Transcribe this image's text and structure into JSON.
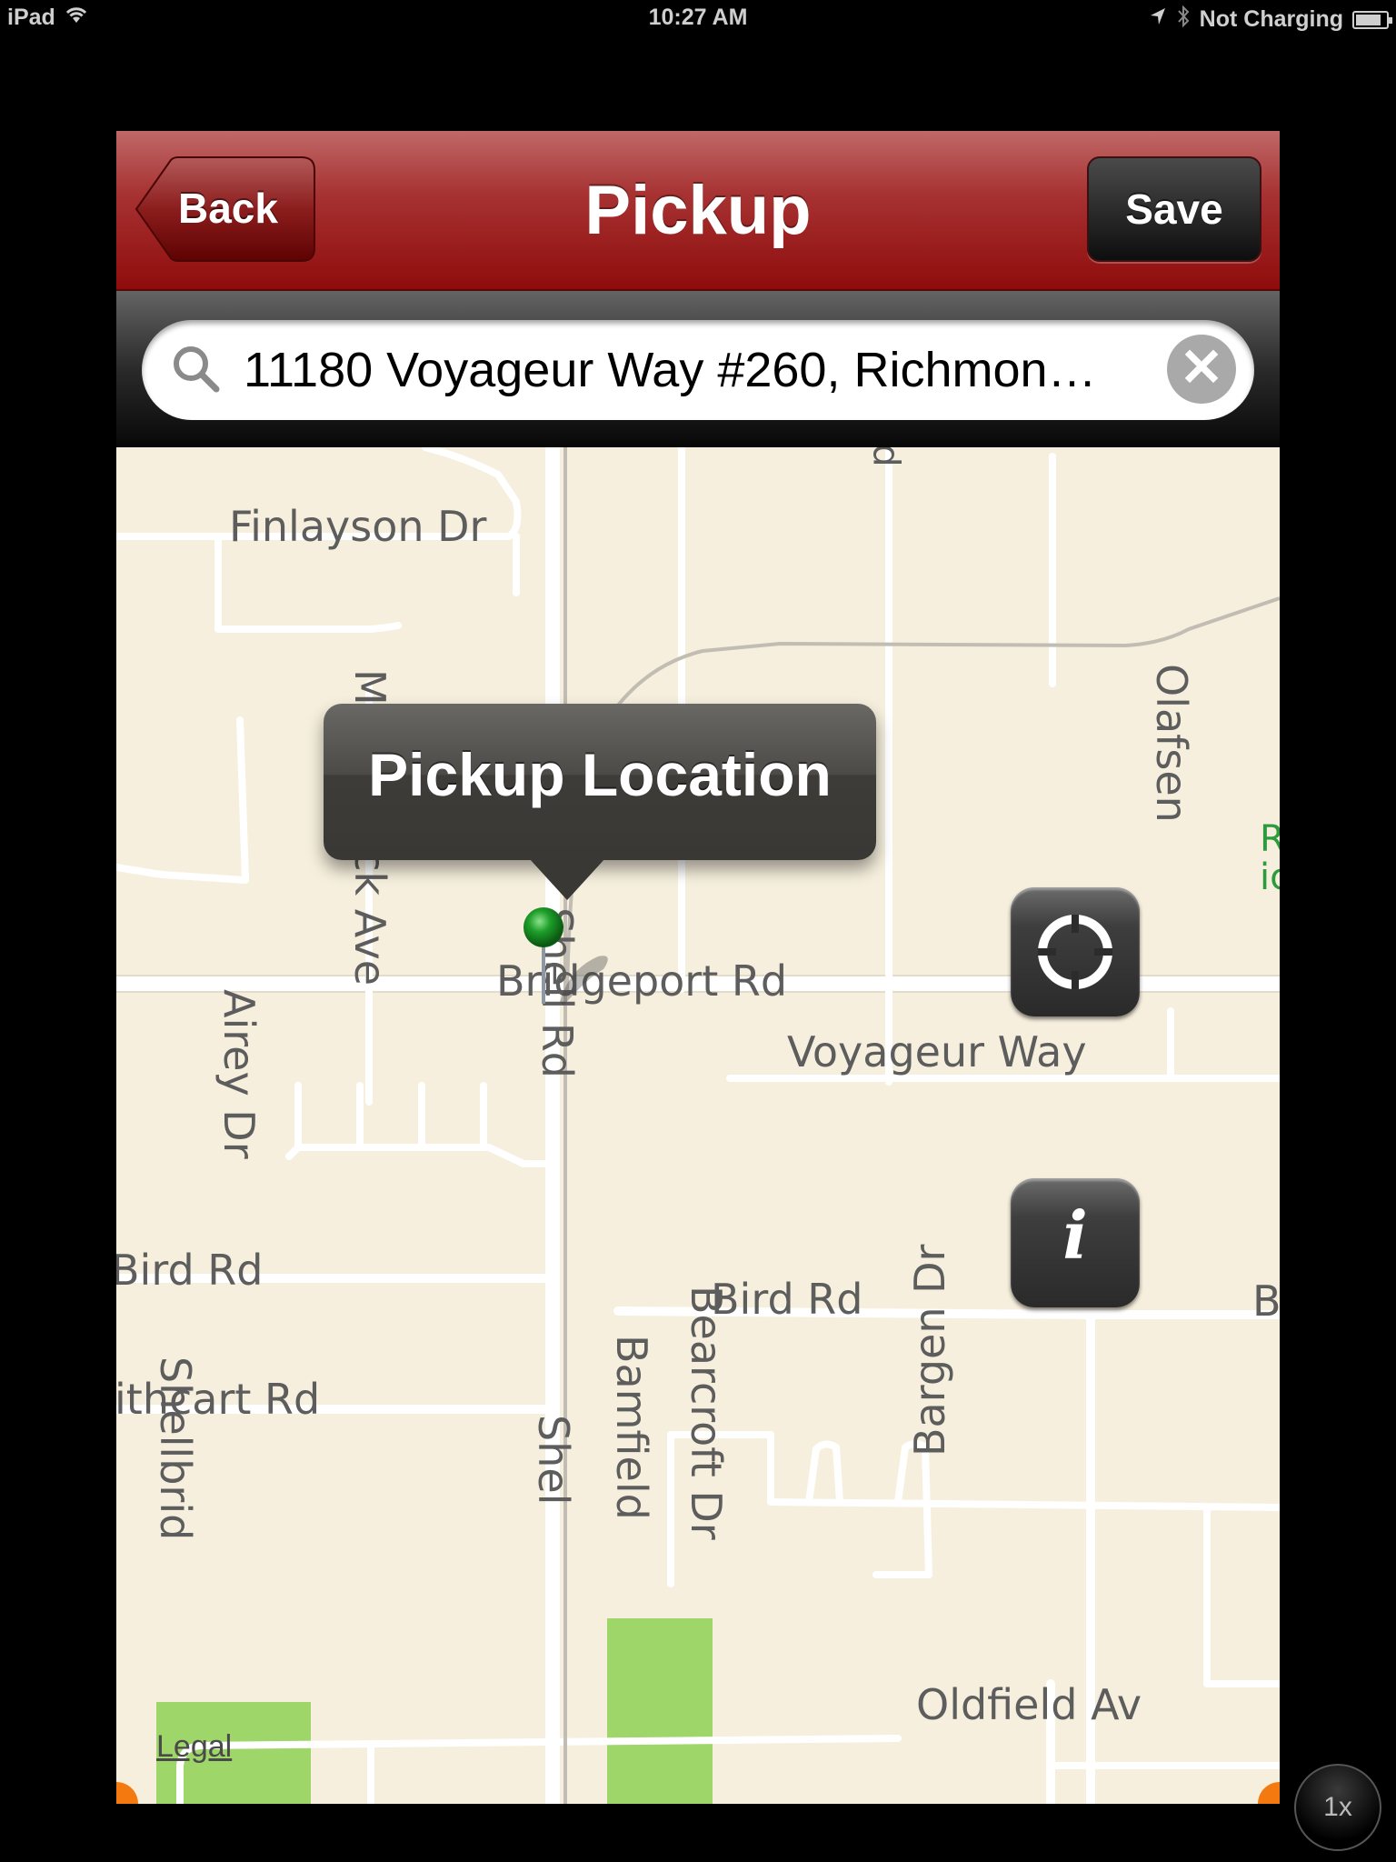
{
  "status_bar": {
    "device": "iPad",
    "time": "10:27 AM",
    "charging_status": "Not Charging",
    "battery_level": 0.85,
    "icons": [
      "wifi-icon",
      "location-arrow-icon",
      "bluetooth-icon",
      "battery-icon"
    ]
  },
  "navbar": {
    "title": "Pickup",
    "back_label": "Back",
    "save_label": "Save"
  },
  "search": {
    "value": "11180 Voyageur Way #260, Richmon…",
    "icon": "search-icon",
    "clear_icon": "clear-icon"
  },
  "map": {
    "callout_title": "Pickup Location",
    "pin_color": "#1e9e2a",
    "legal_label": "Legal",
    "streets": {
      "finlayson": "Finlayson Dr",
      "mckessock": "McKessock Ave",
      "bridgeport": "Bridgeport Rd",
      "airey": "Airey Dr",
      "shell": "Shell Rd",
      "voyageur": "Voyageur Way",
      "olafsen": "Olafsen",
      "bird_left": "Bird Rd",
      "bird_center": "Bird Rd",
      "bird_right": "Bi",
      "cathcart": "ithcart Rd",
      "shellbridge": "Shellbrid",
      "shell_bottom": "Shel",
      "bamfield": "Bamfield",
      "bearcroft": "Bearcroft Dr",
      "bargen": "Bargen Dr",
      "oldfield": "Oldfield Av",
      "top_partial": "d",
      "green_partial_1": "Ri",
      "green_partial_2": "ic"
    },
    "controls": {
      "locate_icon": "crosshair-icon",
      "info_label": "i"
    }
  },
  "zoom_indicator": "1x",
  "colors": {
    "navbar_red": "#a01818",
    "map_bg": "#f6efdd",
    "park_green": "#9fd66a",
    "callout_bg": "#44423f"
  }
}
